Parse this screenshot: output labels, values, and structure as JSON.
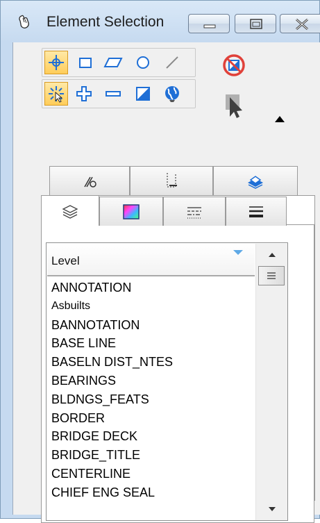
{
  "window": {
    "title": "Element Selection",
    "buttons": [
      "minimize",
      "maximize",
      "close"
    ]
  },
  "toolbar": {
    "row1": [
      "element-select-icon",
      "rectangle-icon",
      "parallelogram-icon",
      "circle-icon",
      "line-icon"
    ],
    "row2": [
      "fence-select-icon",
      "add-icon",
      "subtract-icon",
      "invert-icon",
      "globe-icon"
    ],
    "right": [
      "clear-selection-icon",
      "pointer-icon",
      "expand-arrow-icon"
    ]
  },
  "tabs": {
    "top_row": [
      "modify-tab",
      "attributes-tab",
      "view-tab"
    ],
    "bottom_row": [
      "levels-tab",
      "color-tab",
      "line-style-tab",
      "weight-tab"
    ]
  },
  "level_list": {
    "column_header": "Level",
    "items": [
      "ANNOTATION",
      "Asbuilts",
      "BANNOTATION",
      "BASE LINE",
      "BASELN DIST_NTES",
      "BEARINGS",
      "BLDNGS_FEATS",
      "BORDER",
      "BRIDGE DECK",
      "BRIDGE_TITLE",
      "CENTERLINE",
      "CHIEF ENG SEAL"
    ]
  },
  "colors": {
    "title_bar": "#c6daf0",
    "active_tool": "#ffcd5a",
    "clear_selection": "#e0413a",
    "tool_blue": "#1f6fd6"
  }
}
